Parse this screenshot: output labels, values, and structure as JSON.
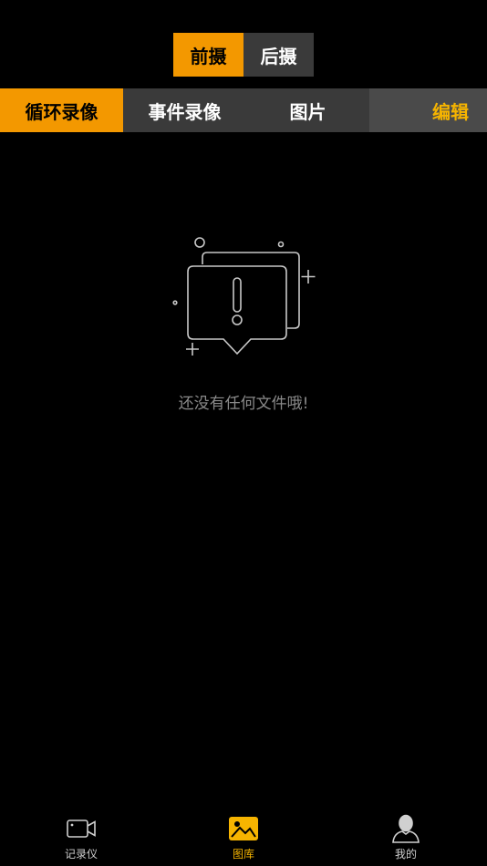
{
  "camera_switch": {
    "front": "前摄",
    "rear": "后摄",
    "active": "front"
  },
  "tabs": [
    {
      "label": "循环录像",
      "active": true
    },
    {
      "label": "事件录像",
      "active": false
    },
    {
      "label": "图片",
      "active": false
    }
  ],
  "edit_label": "编辑",
  "empty_state": {
    "text": "还没有任何文件哦!"
  },
  "bottom_nav": [
    {
      "label": "记录仪",
      "icon": "camera-icon",
      "active": false
    },
    {
      "label": "图库",
      "icon": "gallery-icon",
      "active": true
    },
    {
      "label": "我的",
      "icon": "profile-icon",
      "active": false
    }
  ],
  "colors": {
    "accent": "#f39800",
    "edit": "#f6b400",
    "tab_bg": "#3a3a3a",
    "muted_text": "#8a8a8a"
  }
}
